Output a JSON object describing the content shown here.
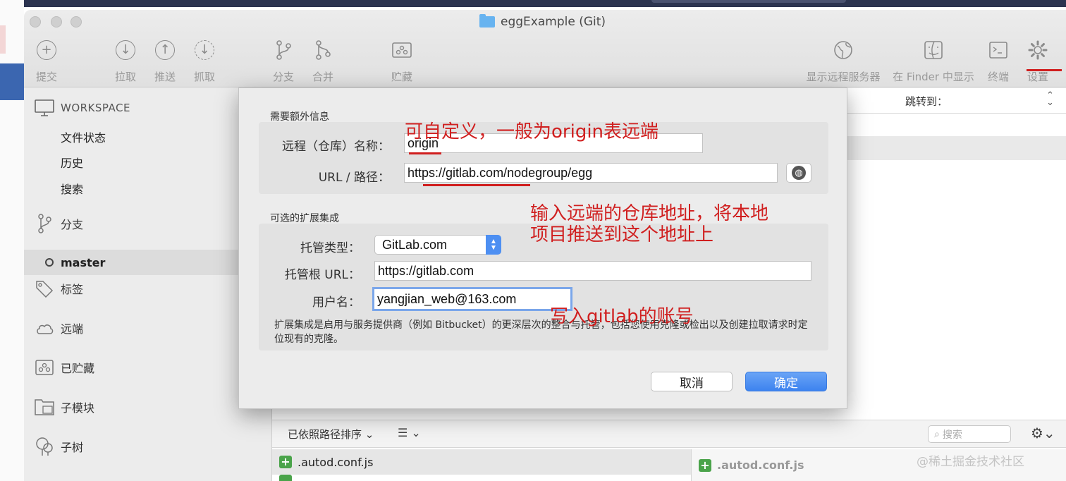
{
  "window": {
    "title": "eggExample (Git)"
  },
  "toolbar": {
    "items": [
      {
        "label": "提交",
        "icon": "plus-circle-icon"
      },
      {
        "label": "拉取",
        "icon": "arrow-down-circle-icon"
      },
      {
        "label": "推送",
        "icon": "arrow-up-circle-icon"
      },
      {
        "label": "抓取",
        "icon": "fetch-dashed-circle-icon"
      },
      {
        "label": "分支",
        "icon": "branch-icon"
      },
      {
        "label": "合并",
        "icon": "merge-icon"
      },
      {
        "label": "贮藏",
        "icon": "stash-icon"
      },
      {
        "label": "显示远程服务器",
        "icon": "globe-icon"
      },
      {
        "label": "在 Finder 中显示",
        "icon": "finder-icon"
      },
      {
        "label": "终端",
        "icon": "terminal-icon"
      },
      {
        "label": "设置",
        "icon": "gear-icon"
      }
    ]
  },
  "sidebar": {
    "workspace_label": "WORKSPACE",
    "workspace_items": [
      "文件状态",
      "历史",
      "搜索"
    ],
    "sections": [
      {
        "label": "分支",
        "icon": "branch-icon"
      },
      {
        "label": "标签",
        "icon": "tag-icon"
      },
      {
        "label": "远端",
        "icon": "cloud-icon"
      },
      {
        "label": "已贮藏",
        "icon": "stash-icon"
      },
      {
        "label": "子模块",
        "icon": "submodule-icon"
      },
      {
        "label": "子树",
        "icon": "subtree-icon"
      }
    ],
    "current_branch": "master"
  },
  "main": {
    "jump_label": "跳转到：",
    "sort_label": "已依照路径排序 ⌄",
    "search_placeholder": "搜索",
    "file_name": ".autod.conf.js"
  },
  "dialog": {
    "section1_title": "需要额外信息",
    "remote_name_label": "远程（仓库）名称：",
    "remote_name_value": "origin",
    "url_label": "URL / 路径：",
    "url_value": "https://gitlab.com/nodegroup/egg",
    "section2_title": "可选的扩展集成",
    "host_type_label": "托管类型：",
    "host_type_value": "GitLab.com",
    "host_root_label": "托管根 URL：",
    "host_root_value": "https://gitlab.com",
    "username_label": "用户名：",
    "username_value": "yangjian_web@163.com",
    "description": "扩展集成是启用与服务提供商（例如 Bitbucket）的更深层次的整合与托管，包括您使用克隆或检出以及创建拉取请求时定位现有的克隆。",
    "cancel_label": "取消",
    "ok_label": "确定"
  },
  "annotations": {
    "name_note": "可自定义，一般为origin表远端",
    "url_note_line1": "输入远端的仓库地址，将本地",
    "url_note_line2": "项目推送到这个地址上",
    "account_note": "写入gitlab的账号"
  },
  "watermark": "@稀土掘金技术社区",
  "colors": {
    "accent_blue": "#3d83ef",
    "annotation_red": "#d01f1f",
    "add_green": "#4aa34a"
  }
}
